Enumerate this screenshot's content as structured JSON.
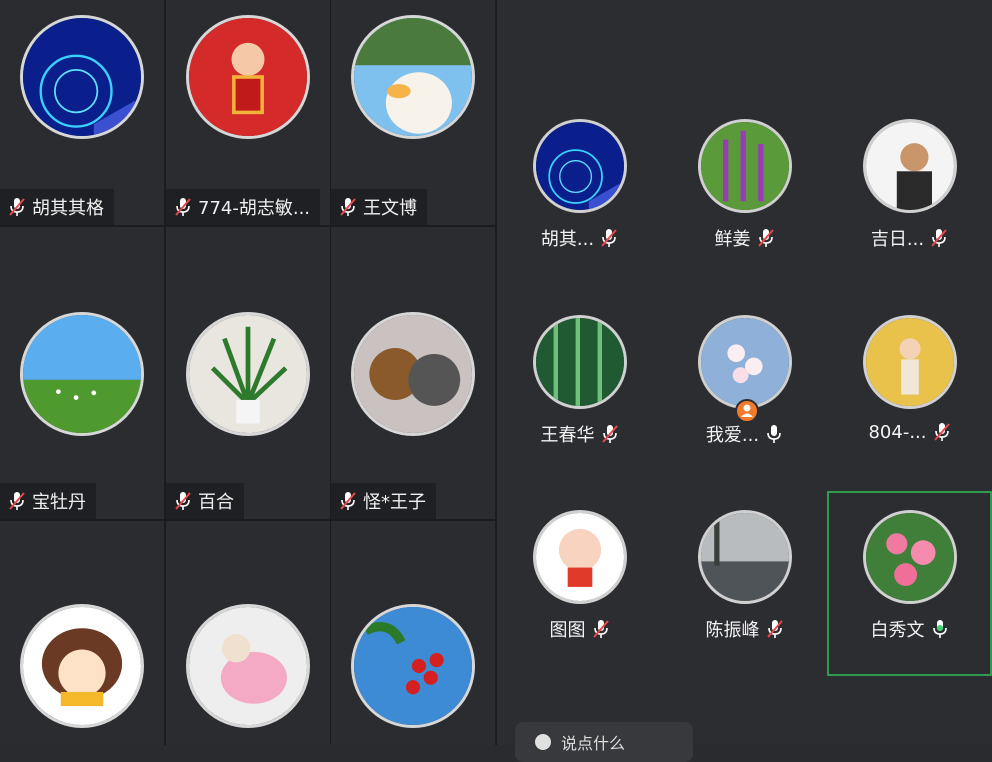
{
  "left_grid": {
    "tiles": [
      {
        "name": "胡其其格",
        "muted": true,
        "avatar": "ferris-wheel-night"
      },
      {
        "name": "774-胡志敏...",
        "muted": true,
        "avatar": "cartoon-red"
      },
      {
        "name": "王文博",
        "muted": true,
        "avatar": "duck-toy"
      },
      {
        "name": "宝牡丹",
        "muted": true,
        "avatar": "grassland-sheep"
      },
      {
        "name": "百合",
        "muted": true,
        "avatar": "potted-plant"
      },
      {
        "name": "怪*王子",
        "muted": true,
        "avatar": "plush-toys"
      },
      {
        "name": "",
        "muted": false,
        "avatar": "cartoon-girl"
      },
      {
        "name": "",
        "muted": false,
        "avatar": "puppy-pink"
      },
      {
        "name": "",
        "muted": false,
        "avatar": "red-berries"
      }
    ]
  },
  "right_panel": {
    "people": [
      {
        "name": "胡其...",
        "muted": true,
        "avatar": "ferris-wheel-night"
      },
      {
        "name": "鲜姜",
        "muted": true,
        "avatar": "purple-flowers"
      },
      {
        "name": "吉日...",
        "muted": true,
        "avatar": "man-photo"
      },
      {
        "name": "王春华",
        "muted": true,
        "avatar": "bamboo"
      },
      {
        "name": "我爱...",
        "muted": false,
        "avatar": "cherry-blossom",
        "host": true
      },
      {
        "name": "804-...",
        "muted": true,
        "avatar": "girl-field"
      },
      {
        "name": "图图",
        "muted": true,
        "avatar": "cartoon-baby"
      },
      {
        "name": "陈振峰",
        "muted": true,
        "avatar": "river-trees"
      },
      {
        "name": "白秀文",
        "muted": false,
        "speaking": true,
        "avatar": "pink-roses"
      }
    ],
    "bottom_pill_text": "说点什么"
  },
  "colors": {
    "muted_red": "#e5484d",
    "speaking_green": "#3ccf6a",
    "selected_border": "#2e9b4e",
    "host_badge": "#f07b2a"
  }
}
